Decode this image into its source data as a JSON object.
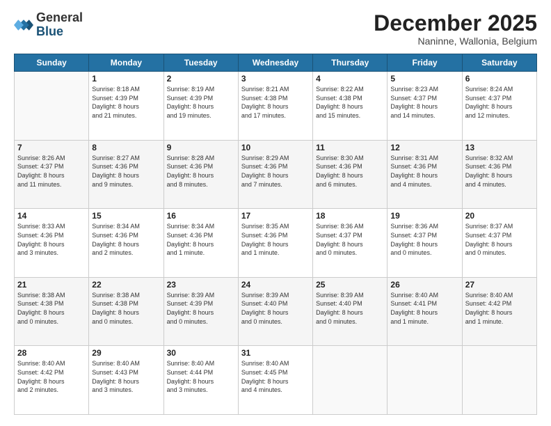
{
  "logo": {
    "general": "General",
    "blue": "Blue"
  },
  "header": {
    "month": "December 2025",
    "location": "Naninne, Wallonia, Belgium"
  },
  "weekdays": [
    "Sunday",
    "Monday",
    "Tuesday",
    "Wednesday",
    "Thursday",
    "Friday",
    "Saturday"
  ],
  "weeks": [
    [
      {
        "day": "",
        "info": ""
      },
      {
        "day": "1",
        "info": "Sunrise: 8:18 AM\nSunset: 4:39 PM\nDaylight: 8 hours\nand 21 minutes."
      },
      {
        "day": "2",
        "info": "Sunrise: 8:19 AM\nSunset: 4:39 PM\nDaylight: 8 hours\nand 19 minutes."
      },
      {
        "day": "3",
        "info": "Sunrise: 8:21 AM\nSunset: 4:38 PM\nDaylight: 8 hours\nand 17 minutes."
      },
      {
        "day": "4",
        "info": "Sunrise: 8:22 AM\nSunset: 4:38 PM\nDaylight: 8 hours\nand 15 minutes."
      },
      {
        "day": "5",
        "info": "Sunrise: 8:23 AM\nSunset: 4:37 PM\nDaylight: 8 hours\nand 14 minutes."
      },
      {
        "day": "6",
        "info": "Sunrise: 8:24 AM\nSunset: 4:37 PM\nDaylight: 8 hours\nand 12 minutes."
      }
    ],
    [
      {
        "day": "7",
        "info": "Sunrise: 8:26 AM\nSunset: 4:37 PM\nDaylight: 8 hours\nand 11 minutes."
      },
      {
        "day": "8",
        "info": "Sunrise: 8:27 AM\nSunset: 4:36 PM\nDaylight: 8 hours\nand 9 minutes."
      },
      {
        "day": "9",
        "info": "Sunrise: 8:28 AM\nSunset: 4:36 PM\nDaylight: 8 hours\nand 8 minutes."
      },
      {
        "day": "10",
        "info": "Sunrise: 8:29 AM\nSunset: 4:36 PM\nDaylight: 8 hours\nand 7 minutes."
      },
      {
        "day": "11",
        "info": "Sunrise: 8:30 AM\nSunset: 4:36 PM\nDaylight: 8 hours\nand 6 minutes."
      },
      {
        "day": "12",
        "info": "Sunrise: 8:31 AM\nSunset: 4:36 PM\nDaylight: 8 hours\nand 4 minutes."
      },
      {
        "day": "13",
        "info": "Sunrise: 8:32 AM\nSunset: 4:36 PM\nDaylight: 8 hours\nand 4 minutes."
      }
    ],
    [
      {
        "day": "14",
        "info": "Sunrise: 8:33 AM\nSunset: 4:36 PM\nDaylight: 8 hours\nand 3 minutes."
      },
      {
        "day": "15",
        "info": "Sunrise: 8:34 AM\nSunset: 4:36 PM\nDaylight: 8 hours\nand 2 minutes."
      },
      {
        "day": "16",
        "info": "Sunrise: 8:34 AM\nSunset: 4:36 PM\nDaylight: 8 hours\nand 1 minute."
      },
      {
        "day": "17",
        "info": "Sunrise: 8:35 AM\nSunset: 4:36 PM\nDaylight: 8 hours\nand 1 minute."
      },
      {
        "day": "18",
        "info": "Sunrise: 8:36 AM\nSunset: 4:37 PM\nDaylight: 8 hours\nand 0 minutes."
      },
      {
        "day": "19",
        "info": "Sunrise: 8:36 AM\nSunset: 4:37 PM\nDaylight: 8 hours\nand 0 minutes."
      },
      {
        "day": "20",
        "info": "Sunrise: 8:37 AM\nSunset: 4:37 PM\nDaylight: 8 hours\nand 0 minutes."
      }
    ],
    [
      {
        "day": "21",
        "info": "Sunrise: 8:38 AM\nSunset: 4:38 PM\nDaylight: 8 hours\nand 0 minutes."
      },
      {
        "day": "22",
        "info": "Sunrise: 8:38 AM\nSunset: 4:38 PM\nDaylight: 8 hours\nand 0 minutes."
      },
      {
        "day": "23",
        "info": "Sunrise: 8:39 AM\nSunset: 4:39 PM\nDaylight: 8 hours\nand 0 minutes."
      },
      {
        "day": "24",
        "info": "Sunrise: 8:39 AM\nSunset: 4:40 PM\nDaylight: 8 hours\nand 0 minutes."
      },
      {
        "day": "25",
        "info": "Sunrise: 8:39 AM\nSunset: 4:40 PM\nDaylight: 8 hours\nand 0 minutes."
      },
      {
        "day": "26",
        "info": "Sunrise: 8:40 AM\nSunset: 4:41 PM\nDaylight: 8 hours\nand 1 minute."
      },
      {
        "day": "27",
        "info": "Sunrise: 8:40 AM\nSunset: 4:42 PM\nDaylight: 8 hours\nand 1 minute."
      }
    ],
    [
      {
        "day": "28",
        "info": "Sunrise: 8:40 AM\nSunset: 4:42 PM\nDaylight: 8 hours\nand 2 minutes."
      },
      {
        "day": "29",
        "info": "Sunrise: 8:40 AM\nSunset: 4:43 PM\nDaylight: 8 hours\nand 3 minutes."
      },
      {
        "day": "30",
        "info": "Sunrise: 8:40 AM\nSunset: 4:44 PM\nDaylight: 8 hours\nand 3 minutes."
      },
      {
        "day": "31",
        "info": "Sunrise: 8:40 AM\nSunset: 4:45 PM\nDaylight: 8 hours\nand 4 minutes."
      },
      {
        "day": "",
        "info": ""
      },
      {
        "day": "",
        "info": ""
      },
      {
        "day": "",
        "info": ""
      }
    ]
  ]
}
